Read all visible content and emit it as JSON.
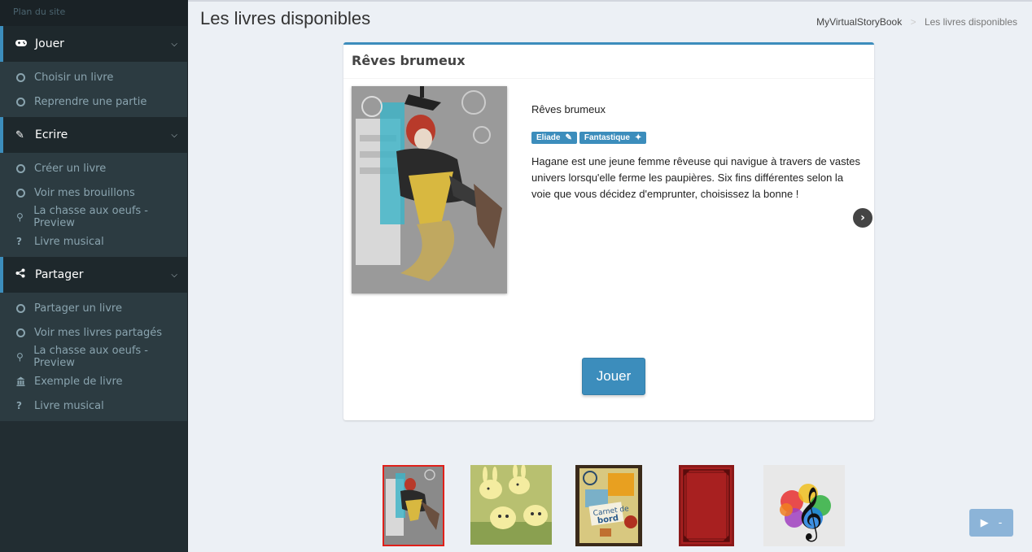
{
  "sidebar": {
    "header": "Plan du site",
    "sections": [
      {
        "label": "Jouer",
        "icon": "gamepad-icon",
        "items": [
          {
            "label": "Choisir un livre",
            "icon": "circle-icon"
          },
          {
            "label": "Reprendre une partie",
            "icon": "circle-icon"
          }
        ]
      },
      {
        "label": "Ecrire",
        "icon": "pencil-icon",
        "items": [
          {
            "label": "Créer un livre",
            "icon": "circle-icon"
          },
          {
            "label": "Voir mes brouillons",
            "icon": "circle-icon"
          },
          {
            "label": "La chasse aux oeufs - Preview",
            "icon": "key-icon"
          },
          {
            "label": "Livre musical",
            "icon": "question-icon"
          }
        ]
      },
      {
        "label": "Partager",
        "icon": "share-icon",
        "items": [
          {
            "label": "Partager un livre",
            "icon": "circle-icon"
          },
          {
            "label": "Voir mes livres partagés",
            "icon": "circle-icon"
          },
          {
            "label": "La chasse aux oeufs - Preview",
            "icon": "key-icon"
          },
          {
            "label": "Exemple de livre",
            "icon": "bank-icon"
          },
          {
            "label": "Livre musical",
            "icon": "question-icon"
          }
        ]
      }
    ]
  },
  "page": {
    "title": "Les livres disponibles",
    "breadcrumb": {
      "home": "MyVirtualStoryBook",
      "sep": ">",
      "current": "Les livres disponibles"
    }
  },
  "book": {
    "box_title": "Rêves brumeux",
    "name": "Rêves brumeux",
    "tags": [
      {
        "label": "Eliade",
        "icon": "pencil-icon"
      },
      {
        "label": "Fantastique",
        "icon": "magic-wand-icon"
      }
    ],
    "description": "Hagane est une jeune femme rêveuse qui navigue à travers de vastes univers lorsqu'elle ferme les paupières. Six fins différentes selon la voie que vous décidez d'emprunter, choisissez la bonne !",
    "play_label": "Jouer"
  },
  "thumbnails": [
    {
      "name": "reves-brumeux",
      "selected": true
    },
    {
      "name": "bunnies",
      "selected": false
    },
    {
      "name": "carnet-de-bord",
      "selected": false
    },
    {
      "name": "red-book",
      "selected": false
    },
    {
      "name": "livre-musical",
      "selected": false
    }
  ],
  "fab": {
    "icon": "play-icon",
    "label": "-"
  },
  "colors": {
    "accent": "#3c8dbc",
    "sidebar": "#222d32",
    "background": "#ecf0f5"
  }
}
